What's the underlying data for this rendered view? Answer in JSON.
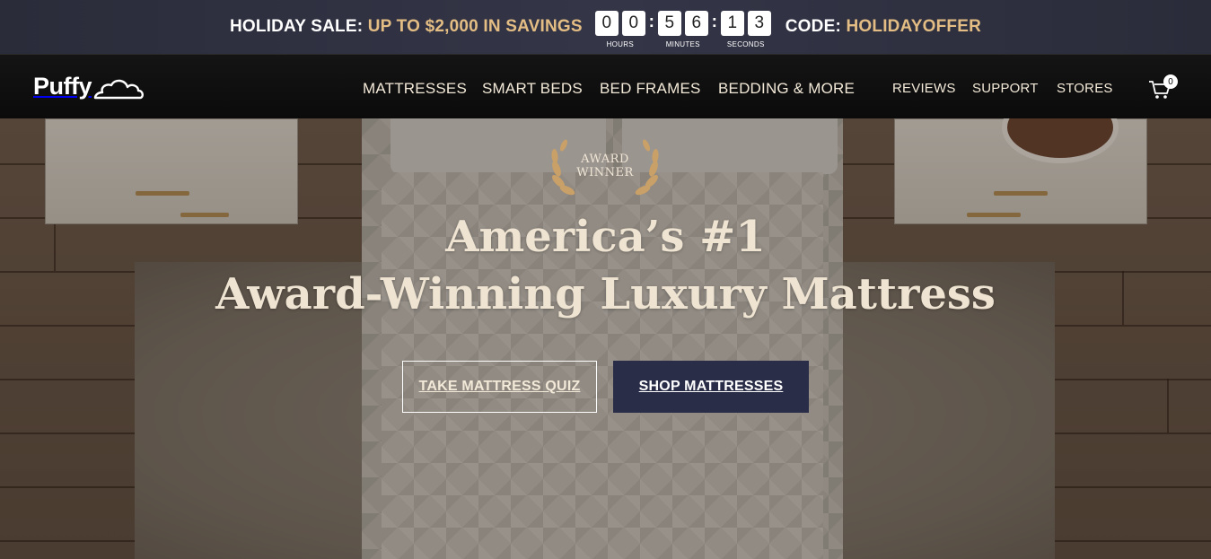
{
  "promo": {
    "label": "HOLIDAY SALE:",
    "highlight": "UP TO $2,000 IN SAVINGS",
    "code_label": "CODE:",
    "code_value": "HOLIDAYOFFER",
    "countdown": {
      "hours": [
        "0",
        "0"
      ],
      "minutes": [
        "5",
        "6"
      ],
      "seconds": [
        "1",
        "3"
      ],
      "hours_label": "HOURS",
      "minutes_label": "MINUTES",
      "seconds_label": "SECONDS",
      "separator": ":"
    }
  },
  "nav": {
    "logo": "Puffy",
    "main": [
      "MATTRESSES",
      "SMART BEDS",
      "BED FRAMES",
      "BEDDING & MORE"
    ],
    "secondary": [
      "REVIEWS",
      "SUPPORT",
      "STORES"
    ],
    "cart_count": "0"
  },
  "hero": {
    "award_line1": "AWARD",
    "award_line2": "WINNER",
    "headline_line1": "America’s #1",
    "headline_line2": "Award-Winning Luxury Mattress",
    "quiz_button": "TAKE MATTRESS QUIZ",
    "shop_button": "SHOP MATTRESSES"
  },
  "colors": {
    "accent_gold": "#e3bd83",
    "button_navy": "#2a2d47",
    "headline_cream": "#efe4d2"
  }
}
